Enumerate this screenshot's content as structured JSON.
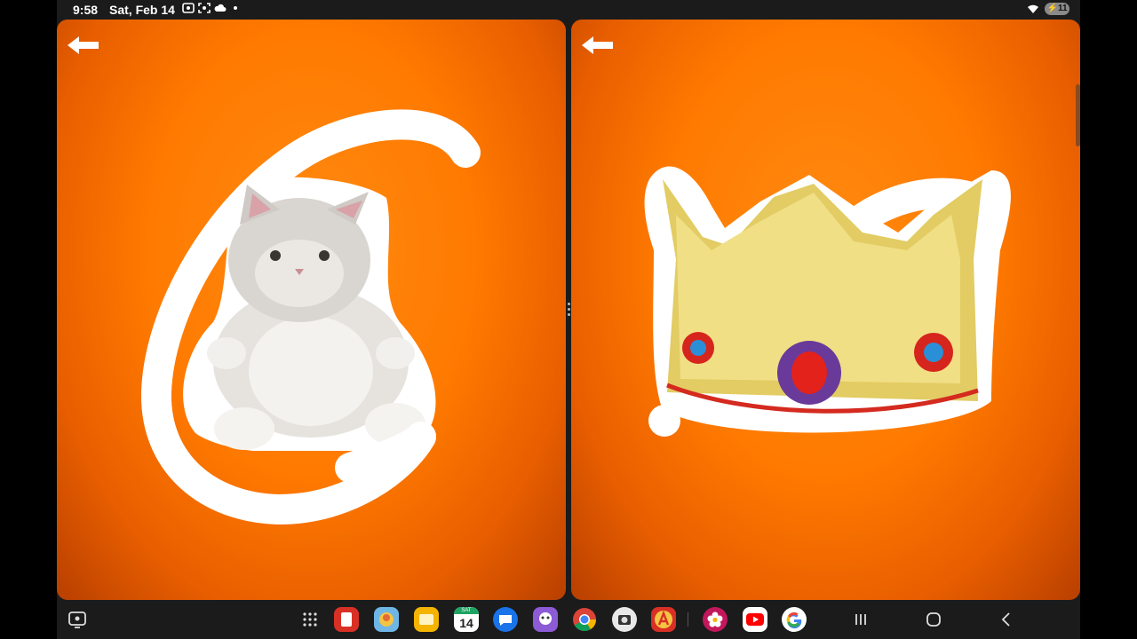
{
  "status_bar": {
    "time": "9:58",
    "date": "Sat, Feb 14",
    "battery": "11",
    "icons": [
      "screenshot-icon",
      "screen-record-icon",
      "cloud-icon",
      "wifi-icon",
      "battery-icon"
    ]
  },
  "panes": {
    "left": {
      "background": "#ff7a00",
      "item": "cat plush toy",
      "letter_icon": "letter-c-stroke"
    },
    "right": {
      "background": "#ff7a00",
      "item": "gold crown",
      "letter_icon": "letter-c-stroke"
    }
  },
  "taskbar": {
    "calendar_day": "14",
    "calendar_label": "SAT",
    "apps": [
      "app-drawer-icon",
      "flashcards-app-icon",
      "game-app-icon",
      "notes-app-icon",
      "calendar-app-icon",
      "messages-app-icon",
      "kids-app-icon",
      "chrome-app-icon",
      "camera-app-icon",
      "alphabet-app-icon",
      "photos-app-icon",
      "youtube-app-icon",
      "google-app-icon"
    ]
  }
}
